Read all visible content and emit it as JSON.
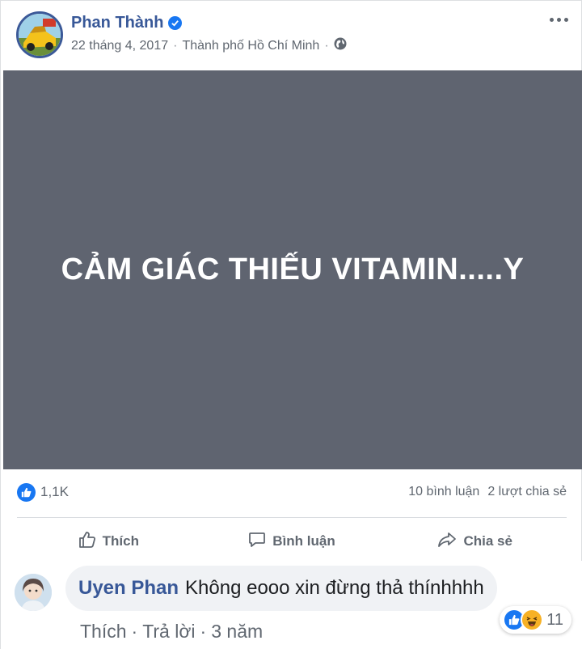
{
  "post": {
    "author": "Phan Thành",
    "date": "22 tháng 4, 2017",
    "location": "Thành phố Hồ Chí Minh",
    "image_text": "CẢM GIÁC THIẾU VITAMIN.....Y",
    "image_bg_color": "#5f6470"
  },
  "stats": {
    "reaction_count": "1,1K",
    "comments": "10 bình luận",
    "shares": "2 lượt chia sẻ"
  },
  "actions": {
    "like": "Thích",
    "comment": "Bình luận",
    "share": "Chia sẻ"
  },
  "comment": {
    "author": "Uyen Phan",
    "text": "Không eooo xin đừng thả thínhhhh",
    "like_link": "Thích",
    "reply_link": "Trả lời",
    "time": "3 năm",
    "reaction_count": "11"
  },
  "colors": {
    "brand_blue": "#1877f2",
    "name_blue": "#385898"
  },
  "icons": [
    "verified-badge-icon",
    "globe-icon",
    "more-options-icon",
    "like-reaction-icon",
    "thumbs-up-icon",
    "comment-bubble-icon",
    "share-arrow-icon",
    "haha-reaction-icon"
  ]
}
